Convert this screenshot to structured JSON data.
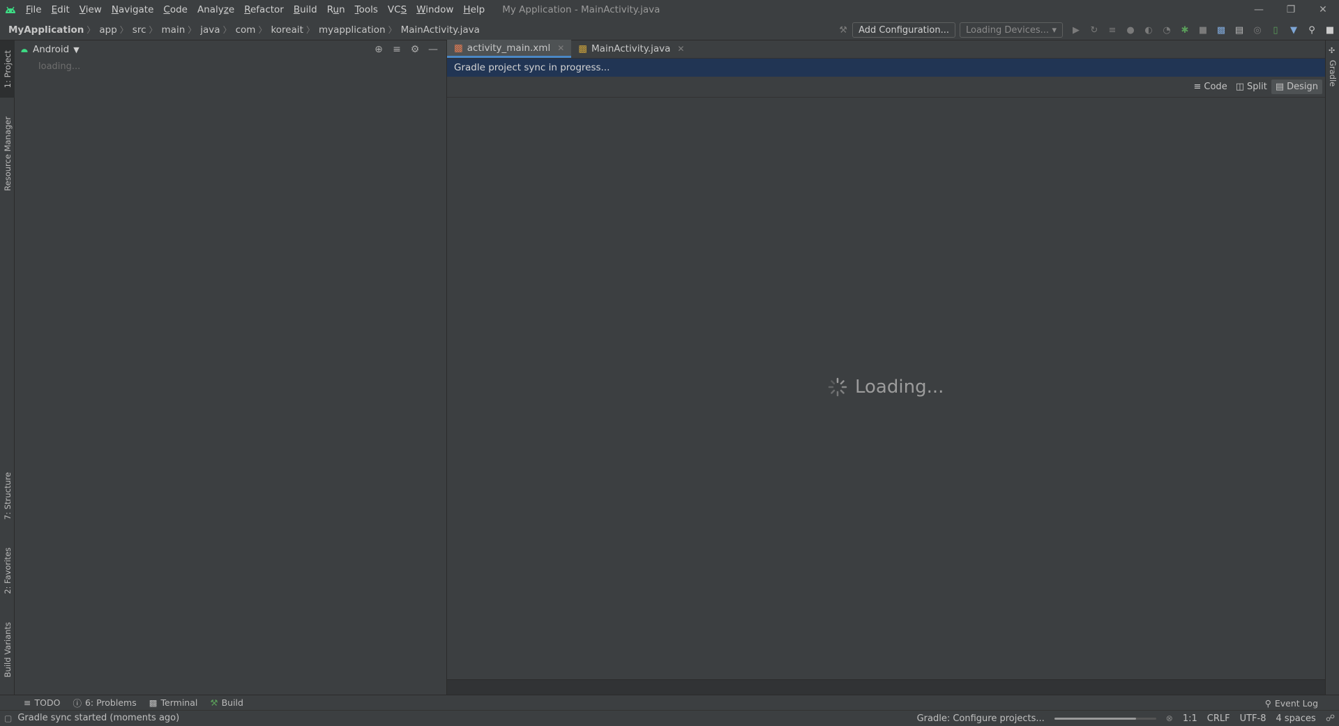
{
  "titlebar": {
    "menus": [
      {
        "pre": "",
        "mn": "F",
        "post": "ile"
      },
      {
        "pre": "",
        "mn": "E",
        "post": "dit"
      },
      {
        "pre": "",
        "mn": "V",
        "post": "iew"
      },
      {
        "pre": "",
        "mn": "N",
        "post": "avigate"
      },
      {
        "pre": "",
        "mn": "C",
        "post": "ode"
      },
      {
        "pre": "Analy",
        "mn": "z",
        "post": "e"
      },
      {
        "pre": "",
        "mn": "R",
        "post": "efactor"
      },
      {
        "pre": "",
        "mn": "B",
        "post": "uild"
      },
      {
        "pre": "R",
        "mn": "u",
        "post": "n"
      },
      {
        "pre": "",
        "mn": "T",
        "post": "ools"
      },
      {
        "pre": "VC",
        "mn": "S",
        "post": ""
      },
      {
        "pre": "",
        "mn": "W",
        "post": "indow"
      },
      {
        "pre": "",
        "mn": "H",
        "post": "elp"
      }
    ],
    "window_title": "My Application - MainActivity.java"
  },
  "navbar": {
    "breadcrumbs": [
      "MyApplication",
      "app",
      "src",
      "main",
      "java",
      "com",
      "koreait",
      "myapplication",
      "MainActivity.java"
    ],
    "add_config": "Add Configuration...",
    "devices": "Loading Devices..."
  },
  "left_strip": {
    "project": "1: Project",
    "resource_manager": "Resource Manager",
    "structure": "7: Structure",
    "favorites": "2: Favorites",
    "build_variants": "Build Variants"
  },
  "right_strip": {
    "gradle": "Gradle"
  },
  "project_panel": {
    "view": "Android",
    "loading": "loading..."
  },
  "editor": {
    "tabs": [
      {
        "label": "activity_main.xml",
        "active": true
      },
      {
        "label": "MainActivity.java",
        "active": false
      }
    ],
    "banner": "Gradle project sync in progress...",
    "view_modes": {
      "code": "Code",
      "split": "Split",
      "design": "Design"
    },
    "loading": "Loading..."
  },
  "toolwindows": {
    "todo": "TODO",
    "problems": "6: Problems",
    "terminal": "Terminal",
    "build": "Build",
    "event_log": "Event Log"
  },
  "status": {
    "message": "Gradle sync started (moments ago)",
    "task": "Gradle: Configure projects...",
    "progress": 0.8,
    "position": "1:1",
    "line_sep": "CRLF",
    "encoding": "UTF-8",
    "indent": "4 spaces"
  },
  "colors": {
    "accent": "#4a88c7",
    "banner": "#213554",
    "android_green": "#3ddc84"
  }
}
